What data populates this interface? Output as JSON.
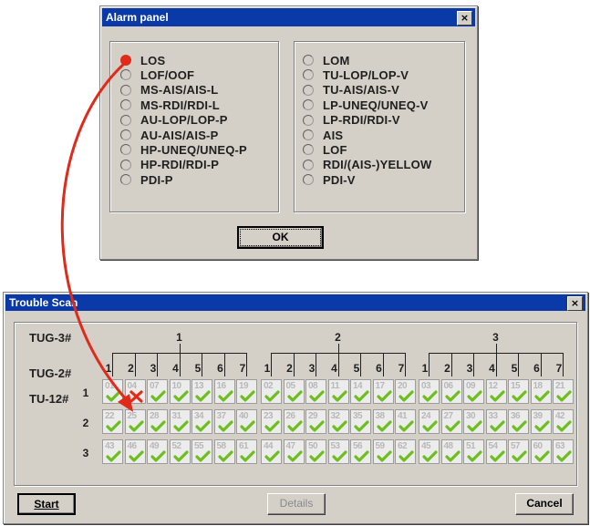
{
  "alarm_panel": {
    "title": "Alarm panel",
    "close_glyph": "×",
    "left_options": [
      "LOS",
      "LOF/OOF",
      "MS-AIS/AIS-L",
      "MS-RDI/RDI-L",
      "AU-LOP/LOP-P",
      "AU-AIS/AIS-P",
      "HP-UNEQ/UNEQ-P",
      "HP-RDI/RDI-P",
      "PDI-P"
    ],
    "right_options": [
      "LOM",
      "TU-LOP/LOP-V",
      "TU-AIS/AIS-V",
      "LP-UNEQ/UNEQ-V",
      "LP-RDI/RDI-V",
      "AIS",
      "LOF",
      "RDI/(AIS-)YELLOW",
      "PDI-V"
    ],
    "selected": "LOS",
    "ok_label": "OK"
  },
  "trouble_scan": {
    "title": "Trouble Scan",
    "close_glyph": "×",
    "tug3_label": "TUG-3#",
    "tug2_label": "TUG-2#",
    "tu12_label": "TU-12#",
    "tug3_numbers": [
      "1",
      "2",
      "3"
    ],
    "tug2_numbers": [
      "1",
      "2",
      "3",
      "4",
      "5",
      "6",
      "7"
    ],
    "row_numbers": [
      "1",
      "2",
      "3"
    ],
    "error_cell": "04",
    "cells": [
      [
        "01",
        "04",
        "07",
        "10",
        "13",
        "16",
        "19",
        "02",
        "05",
        "08",
        "11",
        "14",
        "17",
        "20",
        "03",
        "06",
        "09",
        "12",
        "15",
        "18",
        "21"
      ],
      [
        "22",
        "25",
        "28",
        "31",
        "34",
        "37",
        "40",
        "23",
        "26",
        "29",
        "32",
        "35",
        "38",
        "41",
        "24",
        "27",
        "30",
        "33",
        "36",
        "39",
        "42"
      ],
      [
        "43",
        "46",
        "49",
        "52",
        "55",
        "58",
        "61",
        "44",
        "47",
        "50",
        "53",
        "56",
        "59",
        "62",
        "45",
        "48",
        "51",
        "54",
        "57",
        "60",
        "63"
      ]
    ],
    "start_label": "Start",
    "details_label": "Details",
    "cancel_label": "Cancel"
  },
  "colors": {
    "titlebar": "#0a3aa8",
    "check": "#6cbf1c",
    "error": "#e02a1a",
    "arrow": "#e02a1a"
  }
}
